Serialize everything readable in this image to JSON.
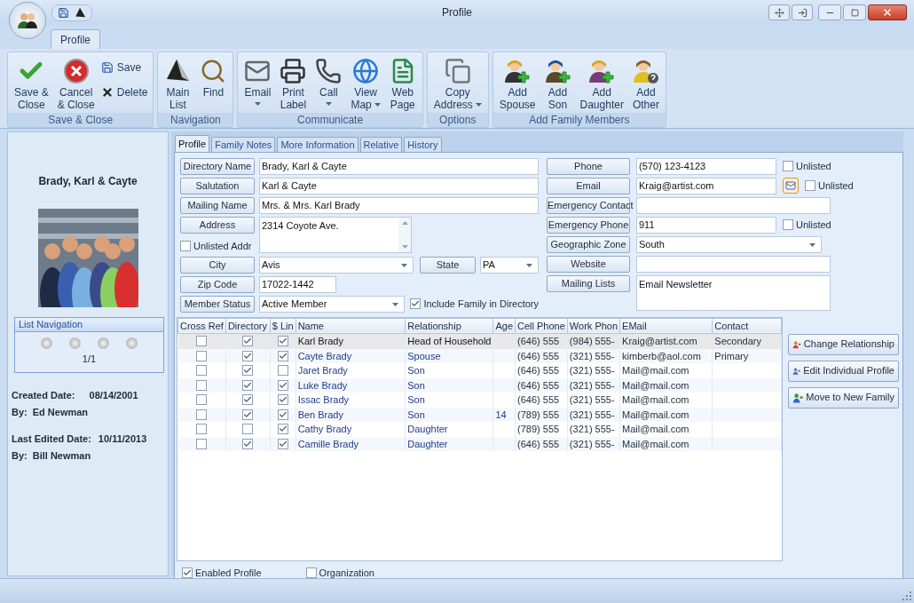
{
  "window": {
    "title": "Profile"
  },
  "ribbon": {
    "tabs": [
      {
        "label": "Profile",
        "selected": true
      }
    ],
    "groups": [
      {
        "label": "Save & Close",
        "buttons": [
          {
            "kind": "large",
            "lines": [
              "Save &",
              "Close"
            ]
          },
          {
            "kind": "large",
            "lines": [
              "Cancel",
              "& Close"
            ]
          },
          {
            "kind": "small",
            "lines": [
              "Save"
            ]
          },
          {
            "kind": "small",
            "lines": [
              "Delete"
            ]
          }
        ]
      },
      {
        "label": "Navigation",
        "buttons": [
          {
            "kind": "large",
            "lines": [
              "Main",
              "List"
            ]
          },
          {
            "kind": "large",
            "lines": [
              "Find"
            ]
          }
        ]
      },
      {
        "label": "Communicate",
        "buttons": [
          {
            "kind": "large",
            "lines": [
              "Email"
            ],
            "dropdown": true
          },
          {
            "kind": "large",
            "lines": [
              "Print",
              "Label"
            ]
          },
          {
            "kind": "large",
            "lines": [
              "Call"
            ],
            "dropdown": true
          },
          {
            "kind": "large",
            "lines": [
              "View",
              "Map"
            ],
            "dropdown": true
          },
          {
            "kind": "large",
            "lines": [
              "Web",
              "Page"
            ]
          }
        ]
      },
      {
        "label": "Options",
        "buttons": [
          {
            "kind": "large",
            "lines": [
              "Copy",
              "Address"
            ],
            "dropdown": true
          }
        ]
      },
      {
        "label": "Add Family Members",
        "buttons": [
          {
            "kind": "large",
            "lines": [
              "Add",
              "Spouse"
            ]
          },
          {
            "kind": "large",
            "lines": [
              "Add",
              "Son"
            ]
          },
          {
            "kind": "large",
            "lines": [
              "Add",
              "Daughter"
            ]
          },
          {
            "kind": "large",
            "lines": [
              "Add",
              "Other"
            ]
          }
        ]
      }
    ]
  },
  "sidebar": {
    "family_name": "Brady, Karl & Cayte",
    "list_navigation": {
      "title": "List Navigation",
      "position": "1/1"
    },
    "created": {
      "label": "Created Date:",
      "date": "08/14/2001",
      "by_label": "By:",
      "by": "Ed Newman"
    },
    "last_edited": {
      "label": "Last Edited Date:",
      "date": "10/11/2013",
      "by_label": "By:",
      "by": "Bill Newman"
    }
  },
  "tabs": [
    {
      "label": "Profile",
      "selected": true
    },
    {
      "label": "Family Notes",
      "selected": false
    },
    {
      "label": "More Information",
      "selected": false
    },
    {
      "label": "Relative",
      "selected": false
    },
    {
      "label": "History",
      "selected": false
    }
  ],
  "form": {
    "left": [
      {
        "label": "Directory Name",
        "value": "Brady, Karl & Cayte",
        "kind": "text"
      },
      {
        "label": "Salutation",
        "value": "Karl & Cayte",
        "kind": "text"
      },
      {
        "label": "Mailing Name",
        "value": "Mrs. & Mrs. Karl Brady",
        "kind": "text"
      },
      {
        "label": "Address",
        "value": "2314 Coyote Ave.",
        "kind": "memo",
        "checkbox": {
          "label": "Unlisted Addr",
          "checked": false
        }
      },
      {
        "label": "City",
        "value": "Avis",
        "kind": "combo",
        "paired": {
          "label": "State",
          "value": "PA"
        }
      },
      {
        "label": "Zip Code",
        "value": "17022-1442",
        "kind": "short"
      },
      {
        "label": "Member Status",
        "value": "Active Member",
        "kind": "combo",
        "checkbox": {
          "label": "Include Family in Directory",
          "checked": true
        }
      }
    ],
    "right": [
      {
        "label": "Phone",
        "value": "(570) 123-4123",
        "kind": "text",
        "checkbox": {
          "label": "Unlisted",
          "checked": false
        }
      },
      {
        "label": "Email",
        "value": "Kraig@artist.com",
        "kind": "email",
        "checkbox": {
          "label": "Unlisted",
          "checked": false
        }
      },
      {
        "label": "Emergency Contact",
        "kind": "wide"
      },
      {
        "label": "Emergency Phone",
        "value": "911",
        "kind": "text",
        "checkbox": {
          "label": "Unlisted",
          "checked": false
        }
      },
      {
        "label": "Geographic Zone",
        "value": "South",
        "kind": "combo"
      },
      {
        "label": "Website",
        "kind": "wide"
      },
      {
        "label": "Mailing Lists",
        "value": "Email Newsletter",
        "kind": "memo"
      }
    ]
  },
  "table": {
    "columns": [
      "Cross Ref",
      "Directory",
      "$ Lin",
      "Name",
      "Relationship",
      "Age",
      "Cell Phone",
      "Work Phon",
      "EMail",
      "Contact"
    ],
    "rows": [
      {
        "selected": true,
        "cross_ref": false,
        "directory": true,
        "link": true,
        "name": "Karl Brady",
        "relationship": "Head of Household",
        "cell_phone": "(646) 555",
        "work_phone": "(984) 555-",
        "email": "Kraig@artist.com",
        "contact": "Secondary"
      },
      {
        "selected": false,
        "cross_ref": false,
        "directory": true,
        "link": true,
        "name": "Cayte Brady",
        "relationship": "Spouse",
        "cell_phone": "(646) 555",
        "work_phone": "(321) 555-",
        "email": "kimberb@aol.com",
        "contact": "Primary"
      },
      {
        "selected": false,
        "cross_ref": false,
        "directory": true,
        "link": false,
        "name": "Jaret Brady",
        "relationship": "Son",
        "cell_phone": "(646) 555",
        "work_phone": "(321) 555-",
        "email": "Mail@mail.com"
      },
      {
        "selected": false,
        "cross_ref": false,
        "directory": true,
        "link": true,
        "name": "Luke Brady",
        "relationship": "Son",
        "cell_phone": "(646) 555",
        "work_phone": "(321) 555-",
        "email": "Mail@mail.com"
      },
      {
        "selected": false,
        "cross_ref": false,
        "directory": true,
        "link": true,
        "name": "Issac Brady",
        "relationship": "Son",
        "cell_phone": "(646) 555",
        "work_phone": "(321) 555-",
        "email": "Mail@mail.com"
      },
      {
        "selected": false,
        "cross_ref": false,
        "directory": true,
        "link": true,
        "name": "Ben Brady",
        "relationship": "Son",
        "age": "14",
        "cell_phone": "(789) 555",
        "work_phone": "(321) 555-",
        "email": "Mail@mail.com"
      },
      {
        "selected": false,
        "cross_ref": false,
        "directory": false,
        "link": true,
        "name": "Cathy Brady",
        "relationship": "Daughter",
        "cell_phone": "(789) 555",
        "work_phone": "(321) 555-",
        "email": "Mail@mail.com"
      },
      {
        "selected": false,
        "cross_ref": false,
        "directory": true,
        "link": true,
        "name": "Camille Brady",
        "relationship": "Daughter",
        "cell_phone": "(646) 555",
        "work_phone": "(321) 555-",
        "email": "Mail@mail.com"
      }
    ]
  },
  "side_buttons": [
    "Change Relationship",
    "Edit Individual Profile",
    "Move to New Family"
  ],
  "options": [
    {
      "label": "Enabled Profile",
      "checked": true
    },
    {
      "label": "Organization",
      "checked": false
    }
  ]
}
